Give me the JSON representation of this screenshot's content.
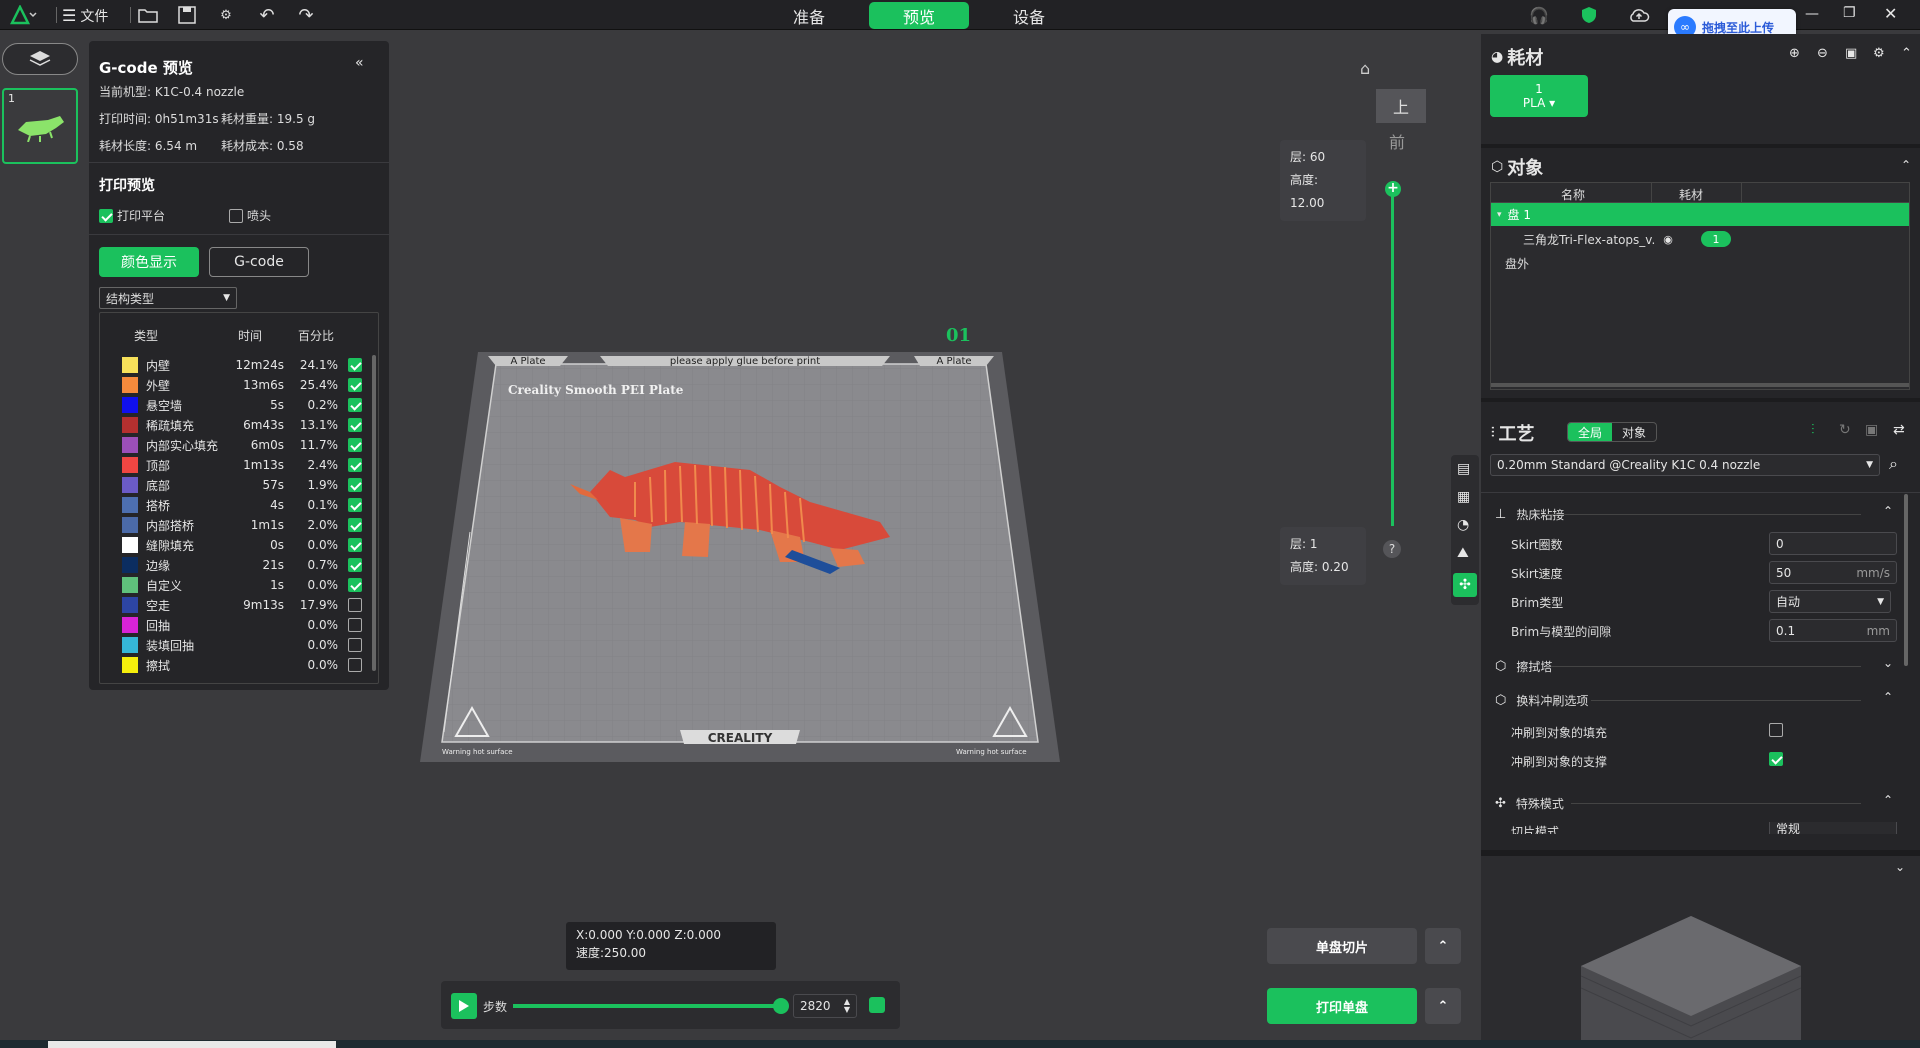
{
  "top": {
    "menu_label": "文件",
    "tabs": [
      "准备",
      "预览",
      "设备"
    ],
    "active_tab": 1,
    "upload_badge": "拖拽至此上传"
  },
  "plate_thumb": {
    "index": "1"
  },
  "gcode": {
    "title": "G-code 预览",
    "machine": "当前机型: K1C-0.4 nozzle",
    "print_time": "打印时间: 0h51m31s",
    "weight": "耗材重量: 19.5 g",
    "length": "耗材长度: 6.54 m",
    "cost": "耗材成本: 0.58",
    "preview_title": "打印预览",
    "opt_plate": "打印平台",
    "opt_nozzle": "喷头",
    "btn_color": "颜色显示",
    "btn_gcode": "G-code",
    "select": "结构类型",
    "col_type": "类型",
    "col_time": "时间",
    "col_pct": "百分比",
    "rows": [
      {
        "name": "内壁",
        "time": "12m24s",
        "pct": "24.1%",
        "color": "#f7e15a",
        "on": true
      },
      {
        "name": "外壁",
        "time": "13m6s",
        "pct": "25.4%",
        "color": "#f58a3c",
        "on": true
      },
      {
        "name": "悬空墙",
        "time": "5s",
        "pct": "0.2%",
        "color": "#1010ee",
        "on": true
      },
      {
        "name": "稀疏填充",
        "time": "6m43s",
        "pct": "13.1%",
        "color": "#b5302f",
        "on": true
      },
      {
        "name": "内部实心填充",
        "time": "6m0s",
        "pct": "11.7%",
        "color": "#9b4fb8",
        "on": true
      },
      {
        "name": "顶部",
        "time": "1m13s",
        "pct": "2.4%",
        "color": "#f04642",
        "on": true
      },
      {
        "name": "底部",
        "time": "57s",
        "pct": "1.9%",
        "color": "#6b5bc7",
        "on": true
      },
      {
        "name": "搭桥",
        "time": "4s",
        "pct": "0.1%",
        "color": "#4d6fb0",
        "on": true
      },
      {
        "name": "内部搭桥",
        "time": "1m1s",
        "pct": "2.0%",
        "color": "#4b6aa8",
        "on": true
      },
      {
        "name": "缝隙填充",
        "time": "0s",
        "pct": "0.0%",
        "color": "#ffffff",
        "on": true
      },
      {
        "name": "边缘",
        "time": "21s",
        "pct": "0.7%",
        "color": "#0b2d60",
        "on": true
      },
      {
        "name": "自定义",
        "time": "1s",
        "pct": "0.0%",
        "color": "#5fc17b",
        "on": true
      },
      {
        "name": "空走",
        "time": "9m13s",
        "pct": "17.9%",
        "color": "#2d45a4",
        "on": false
      },
      {
        "name": "回抽",
        "time": "",
        "pct": "0.0%",
        "color": "#d723d5",
        "on": false
      },
      {
        "name": "装填回抽",
        "time": "",
        "pct": "0.0%",
        "color": "#35b6d6",
        "on": false
      },
      {
        "name": "擦拭",
        "time": "",
        "pct": "0.0%",
        "color": "#f5ee0c",
        "on": false
      }
    ]
  },
  "viewport": {
    "plate_no": "01",
    "bed_title": "Creality Smooth PEI Plate",
    "bed_notice": "please apply glue before print",
    "bed_tab_left": "A Plate",
    "bed_tab_right": "A Plate",
    "brand": "CREALITY",
    "warn": "Warning hot surface",
    "view_top": "上",
    "view_front": "前",
    "layer_top_label": "层: 60",
    "layer_top_height": "高度: 12.00",
    "layer_bot_label": "层: 1",
    "layer_bot_height": "高度: 0.20",
    "coords": "X:0.000  Y:0.000  Z:0.000",
    "speed": "速度:250.00",
    "step_label": "步数",
    "step_value": "2820",
    "progress": 1.0,
    "btn_slice": "单盘切片",
    "btn_print": "打印单盘"
  },
  "right": {
    "filament_title": "耗材",
    "filament_slot": "1",
    "filament_type": "PLA",
    "objects_title": "对象",
    "col_name": "名称",
    "col_material": "耗材",
    "plate_row": "盘 1",
    "object_name": "三角龙Tri-Flex-atops_v.",
    "object_material": "1",
    "outside": "盘外",
    "process_title": "工艺",
    "tab_global": "全局",
    "tab_object": "对象",
    "profile": "0.20mm Standard @Creality K1C 0.4 nozzle",
    "sec_adhesion": "热床粘接",
    "skirt_loops_label": "Skirt圈数",
    "skirt_loops": "0",
    "skirt_speed_label": "Skirt速度",
    "skirt_speed": "50",
    "skirt_speed_unit": "mm/s",
    "brim_type_label": "Brim类型",
    "brim_type": "自动",
    "brim_gap_label": "Brim与模型的间隙",
    "brim_gap": "0.1",
    "brim_gap_unit": "mm",
    "sec_wipe": "擦拭塔",
    "sec_flush": "换料冲刷选项",
    "flush_infill": "冲刷到对象的填充",
    "flush_support": "冲刷到对象的支撑",
    "sec_special": "特殊模式",
    "slice_mode_label": "切片模式",
    "slice_mode": "常规"
  },
  "colors": {
    "accent": "#1bc15d",
    "panel": "#252528",
    "viewport": "#3a3a3d"
  }
}
